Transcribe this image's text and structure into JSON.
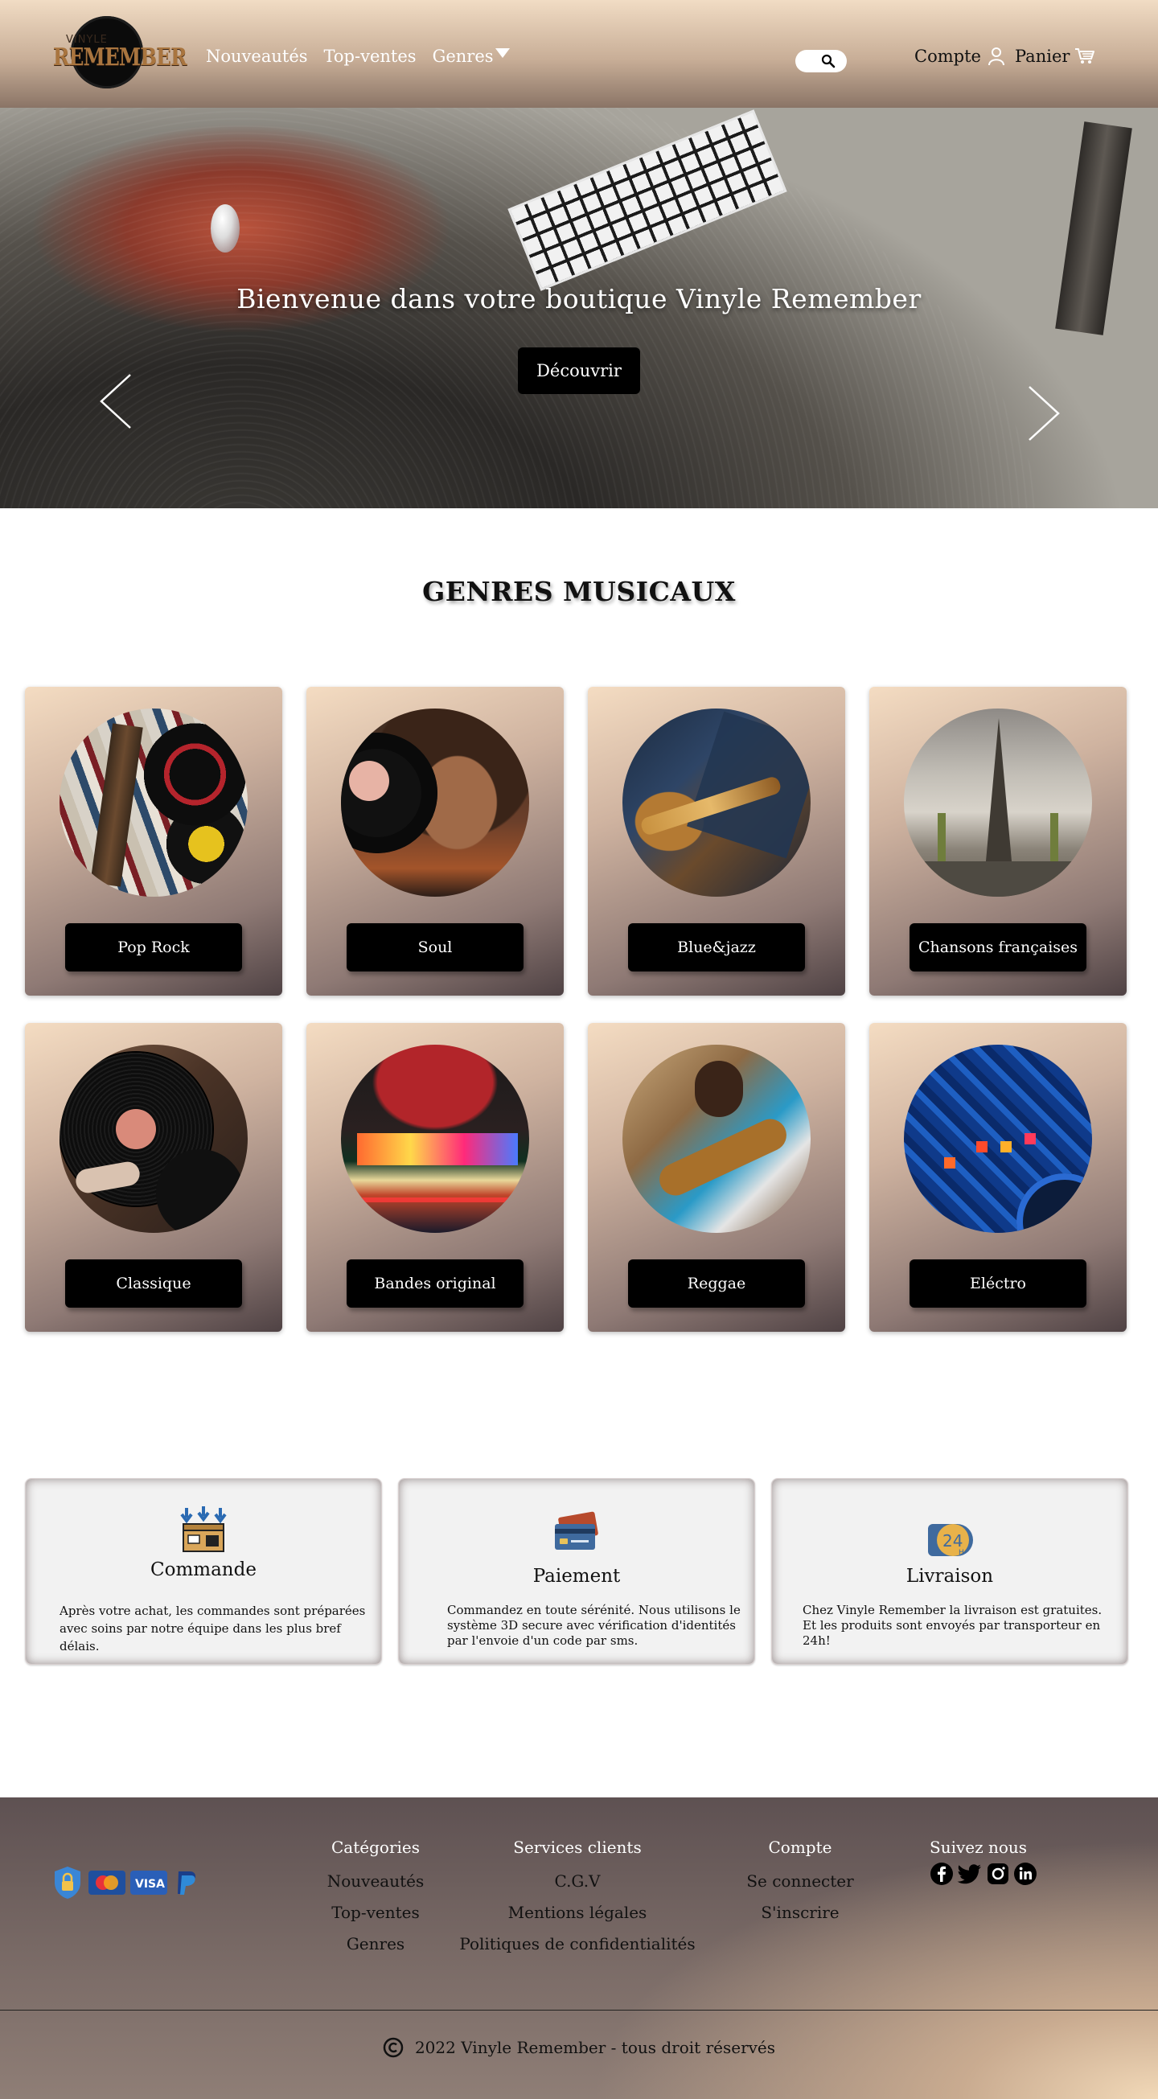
{
  "header": {
    "logo_top": "VINYLE",
    "logo_main": "REMEMBER",
    "nav": [
      {
        "label": "Nouveautés"
      },
      {
        "label": "Top-ventes"
      },
      {
        "label": "Genres"
      }
    ],
    "search_icon": "search-icon",
    "account_label": "Compte",
    "account_icon": "user-icon",
    "cart_label": "Panier",
    "cart_icon": "cart-icon"
  },
  "hero": {
    "title": "Bienvenue dans votre boutique Vinyle Remember",
    "button": "Découvrir",
    "prev_icon": "chevron-left-icon",
    "next_icon": "chevron-right-icon"
  },
  "genres": {
    "title": "GENRES MUSICAUX",
    "items": [
      {
        "label": "Pop Rock"
      },
      {
        "label": "Soul"
      },
      {
        "label": "Blue&jazz"
      },
      {
        "label": "Chansons françaises"
      },
      {
        "label": "Classique"
      },
      {
        "label": "Bandes original"
      },
      {
        "label": "Reggae"
      },
      {
        "label": "Eléctro"
      }
    ]
  },
  "services": [
    {
      "title": "Commande",
      "icon": "package-icon",
      "lines": [
        "Après votre achat, les commandes sont préparées",
        "avec soins par notre équipe dans les plus bref délais."
      ]
    },
    {
      "title": "Paiement",
      "icon": "credit-card-icon",
      "lines": [
        "Commandez en toute sérénité. Nous utilisons le",
        "système 3D secure avec vérification d'identités",
        "par l'envoie d'un code par sms."
      ]
    },
    {
      "title": "Livraison",
      "icon": "delivery-24h-icon",
      "lines": [
        "Chez Vinyle Remember la livraison est gratuites.",
        "Et les produits sont envoyés par transporteur en 24h!"
      ]
    }
  ],
  "footer": {
    "payment_icons": [
      "secure-lock-icon",
      "mastercard-icon",
      "visa-icon",
      "paypal-icon"
    ],
    "visa_text": "VISA",
    "columns": [
      {
        "heading": "Catégories",
        "items": [
          "Nouveautés",
          "Top-ventes",
          "Genres"
        ]
      },
      {
        "heading": "Services clients",
        "items": [
          "C.G.V",
          "Mentions légales",
          "Politiques de confidentialités"
        ]
      },
      {
        "heading": "Compte",
        "items": [
          "Se connecter",
          "S'inscrire"
        ]
      }
    ],
    "social_heading": "Suivez nous",
    "social_icons": [
      "facebook-icon",
      "twitter-icon",
      "instagram-icon",
      "linkedin-icon"
    ],
    "copyright": "2022 Vinyle Remember - tous droit réservés",
    "copyright_icon": "copyright-icon"
  }
}
